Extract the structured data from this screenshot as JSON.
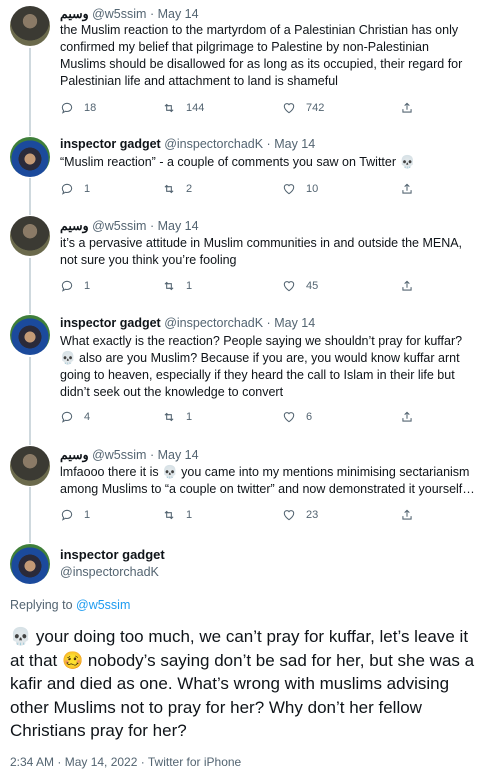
{
  "tweets": [
    {
      "name": "وسيم",
      "handle": "@w5ssim",
      "date": "May 14",
      "text": "the Muslim reaction to the martyrdom of a Palestinian Christian has only confirmed my belief that pilgrimage to Palestine by non-Palestinian Muslims should be disallowed for as long as its occupied, their regard for Palestinian life and attachment to land is shameful",
      "replies": "18",
      "retweets": "144",
      "likes": "742"
    },
    {
      "name": "inspector gadget",
      "handle": "@inspectorchadK",
      "date": "May 14",
      "text": "“Muslim reaction” - a couple of comments you saw on Twitter 💀",
      "replies": "1",
      "retweets": "2",
      "likes": "10"
    },
    {
      "name": "وسيم",
      "handle": "@w5ssim",
      "date": "May 14",
      "text": "it’s a pervasive attitude in Muslim communities in and outside the MENA, not sure you think you’re fooling",
      "replies": "1",
      "retweets": "1",
      "likes": "45"
    },
    {
      "name": "inspector gadget",
      "handle": "@inspectorchadK",
      "date": "May 14",
      "text": "What exactly is the reaction? People saying we shouldn’t pray for kuffar? 💀 also are you Muslim? Because if you are, you would know kuffar arnt going to heaven, especially if they heard the call to Islam in their life but didn’t seek out the knowledge to convert",
      "replies": "4",
      "retweets": "1",
      "likes": "6"
    },
    {
      "name": "وسيم",
      "handle": "@w5ssim",
      "date": "May 14",
      "text": "lmfaooo there it is 💀 you came into my mentions minimising sectarianism among Muslims to “a couple on twitter” and now demonstrated it yourself…",
      "replies": "1",
      "retweets": "1",
      "likes": "23"
    }
  ],
  "main": {
    "name": "inspector gadget",
    "handle": "@inspectorchadK",
    "replying_prefix": "Replying to ",
    "replying_to": "@w5ssim",
    "text": "💀 your doing too much, we can’t pray for kuffar, let’s leave it at that 🥴 nobody’s saying don’t be sad for her, but she was a kafir and died as one. What’s wrong with muslims advising other Muslims not to pray for her? Why don’t her fellow Christians pray for her?",
    "timestamp": "2:34 AM · May 14, 2022 · Twitter for iPhone"
  },
  "separator": "·"
}
